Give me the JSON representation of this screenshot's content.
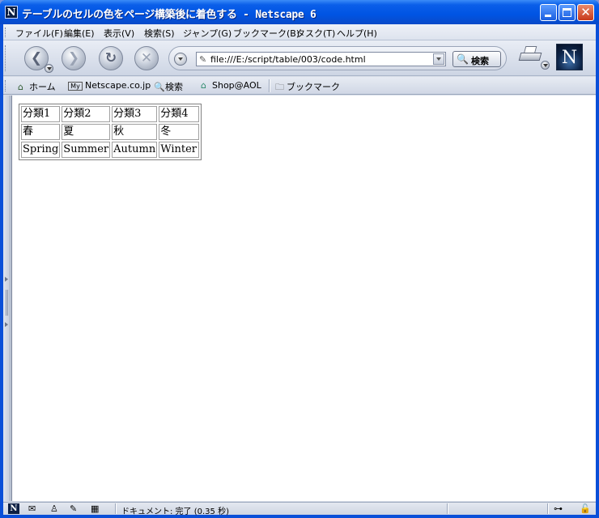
{
  "window": {
    "title": "テーブルのセルの色をページ構築後に着色する - Netscape 6",
    "app_icon": "N"
  },
  "menubar": {
    "items": [
      "ファイル(F)",
      "編集(E)",
      "表示(V)",
      "検索(S)",
      "ジャンプ(G)",
      "ブックマーク(B)",
      "タスク(T)",
      "ヘルプ(H)"
    ]
  },
  "navbar": {
    "url": "file:///E:/script/table/003/code.html",
    "search_label": "検索",
    "logo": "N"
  },
  "personal_toolbar": {
    "items": [
      "ホーム",
      "Netscape.co.jp",
      "検索",
      "Shop@AOL"
    ],
    "bookmarks_label": "ブックマーク",
    "my_badge": "My"
  },
  "table": {
    "rows": [
      [
        "分類1",
        "分類2",
        "分類3",
        "分類4"
      ],
      [
        "春",
        "夏",
        "秋",
        "冬"
      ],
      [
        "Spring",
        "Summer",
        "Autumn",
        "Winter"
      ]
    ]
  },
  "statusbar": {
    "text": "ドキュメント: 完了 (0.35 秒)"
  },
  "icons": {
    "back": "back-arrow-icon",
    "forward": "forward-arrow-icon",
    "reload": "reload-icon",
    "stop": "stop-icon",
    "print": "printer-icon"
  }
}
